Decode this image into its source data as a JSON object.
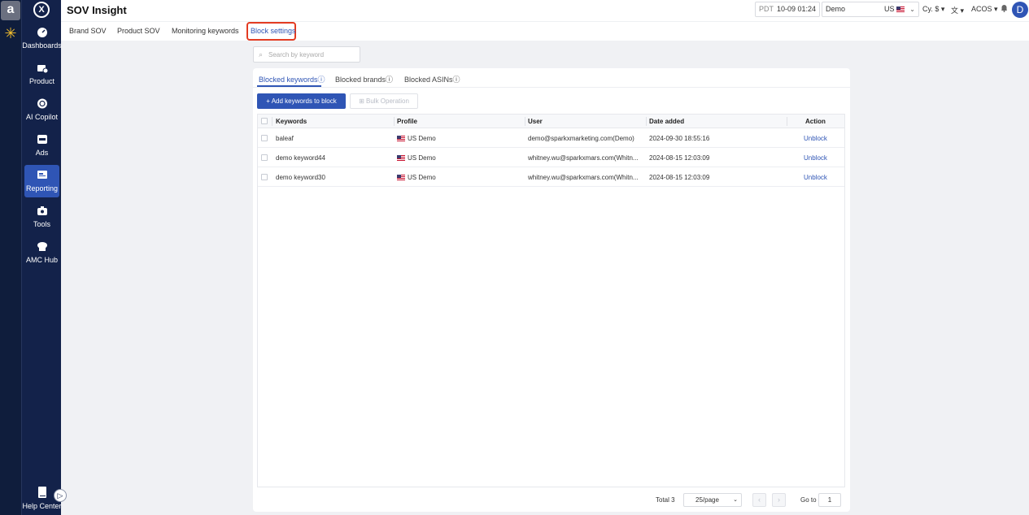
{
  "app": {
    "title": "SOV Insight",
    "logo_letter": "X"
  },
  "rail": {
    "amazon_letter": "a",
    "walmart_symbol": "✳"
  },
  "sidebar": {
    "items": [
      {
        "label": "Dashboards",
        "icon": "gauge-icon"
      },
      {
        "label": "Product",
        "icon": "product-icon"
      },
      {
        "label": "AI Copilot",
        "icon": "ai-copilot-icon"
      },
      {
        "label": "Ads",
        "icon": "ads-icon"
      },
      {
        "label": "Reporting",
        "icon": "reporting-icon",
        "active": true
      },
      {
        "label": "Tools",
        "icon": "tools-icon"
      },
      {
        "label": "AMC Hub",
        "icon": "amc-hub-icon"
      }
    ],
    "help_label": "Help Center",
    "collapse_symbol": "▷"
  },
  "topbar": {
    "timezone": "PDT",
    "datetime": "10-09 01:24",
    "profile": "Demo",
    "country": "US",
    "currency": "Cy. $",
    "language_icon": "translate-icon",
    "metric": "ACOS",
    "avatar_letter": "D"
  },
  "subtabs": [
    {
      "label": "Brand SOV"
    },
    {
      "label": "Product SOV"
    },
    {
      "label": "Monitoring keywords"
    },
    {
      "label": "Block settings",
      "active": true
    }
  ],
  "search": {
    "placeholder": "Search by keyword",
    "value": ""
  },
  "card_tabs": [
    {
      "label": "Blocked keywords",
      "active": true
    },
    {
      "label": "Blocked brands"
    },
    {
      "label": "Blocked ASINs"
    }
  ],
  "info_symbol": "ⓘ",
  "buttons": {
    "add": "Add keywords to block",
    "add_symbol": "+",
    "bulk": "Bulk Operation"
  },
  "table": {
    "columns": [
      "Keywords",
      "Profile",
      "User",
      "Date added",
      "Action"
    ],
    "rows": [
      {
        "keyword": "baleaf",
        "profile": "US Demo",
        "user": "demo@sparkxmarketing.com(Demo)",
        "date": "2024-09-30 18:55:16",
        "action": "Unblock"
      },
      {
        "keyword": "demo keyword44",
        "profile": "US Demo",
        "user": "whitney.wu@sparkxmars.com(Whitn...",
        "date": "2024-08-15 12:03:09",
        "action": "Unblock"
      },
      {
        "keyword": "demo keyword30",
        "profile": "US Demo",
        "user": "whitney.wu@sparkxmars.com(Whitn...",
        "date": "2024-08-15 12:03:09",
        "action": "Unblock"
      }
    ]
  },
  "pagination": {
    "total": "Total 3",
    "page_size": "25/page",
    "prev": "‹",
    "next": "›",
    "goto_label": "Go to",
    "goto_value": "1"
  },
  "colors": {
    "accent": "#2f55b5",
    "sidebar_bg": "#13224a",
    "highlight_border": "#e33b22"
  }
}
